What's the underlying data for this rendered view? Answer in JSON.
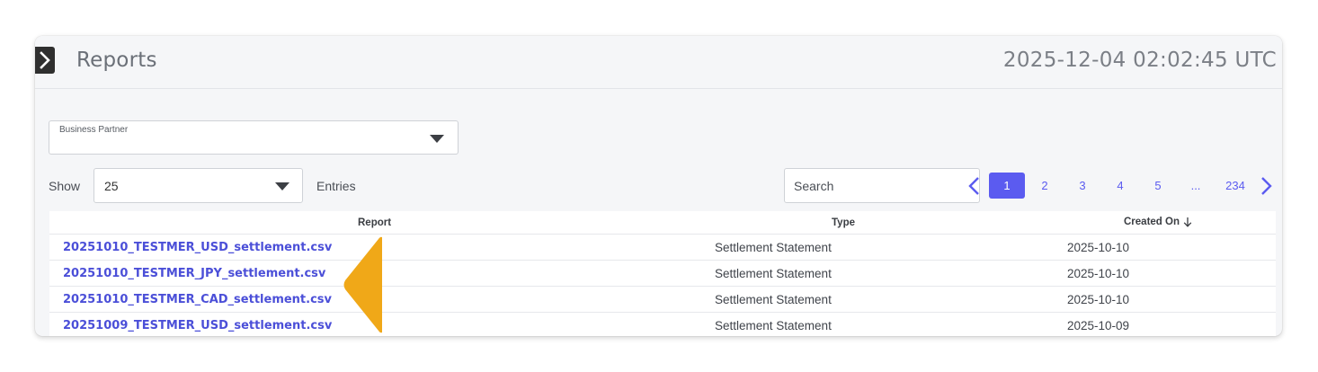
{
  "header": {
    "title": "Reports",
    "timestamp": "2025-12-04 02:02:45 UTC",
    "toggle_icon": "chevron-right-icon"
  },
  "filters": {
    "business_partner_label": "Business Partner",
    "business_partner_value": ""
  },
  "entries": {
    "show_label": "Show",
    "value": "25",
    "suffix_label": "Entries"
  },
  "search": {
    "placeholder": "Search"
  },
  "pagination": {
    "current": "1",
    "pages": [
      "1",
      "2",
      "3",
      "4",
      "5",
      "...",
      "234"
    ],
    "prev_icon": "chevron-left-icon",
    "next_icon": "chevron-right-icon"
  },
  "table": {
    "columns": [
      "Report",
      "Type",
      "Created On"
    ],
    "sort_column": "Created On",
    "sort_direction": "descending",
    "rows": [
      {
        "report": "20251010_TESTMER_USD_settlement.csv",
        "type": "Settlement Statement",
        "created": "2025-10-10"
      },
      {
        "report": "20251010_TESTMER_JPY_settlement.csv",
        "type": "Settlement Statement",
        "created": "2025-10-10"
      },
      {
        "report": "20251010_TESTMER_CAD_settlement.csv",
        "type": "Settlement Statement",
        "created": "2025-10-10"
      },
      {
        "report": "20251009_TESTMER_USD_settlement.csv",
        "type": "Settlement Statement",
        "created": "2025-10-09"
      }
    ]
  },
  "colors": {
    "accent": "#5b5bf0",
    "link": "#4b4fd8",
    "annotation": "#f0a818"
  }
}
